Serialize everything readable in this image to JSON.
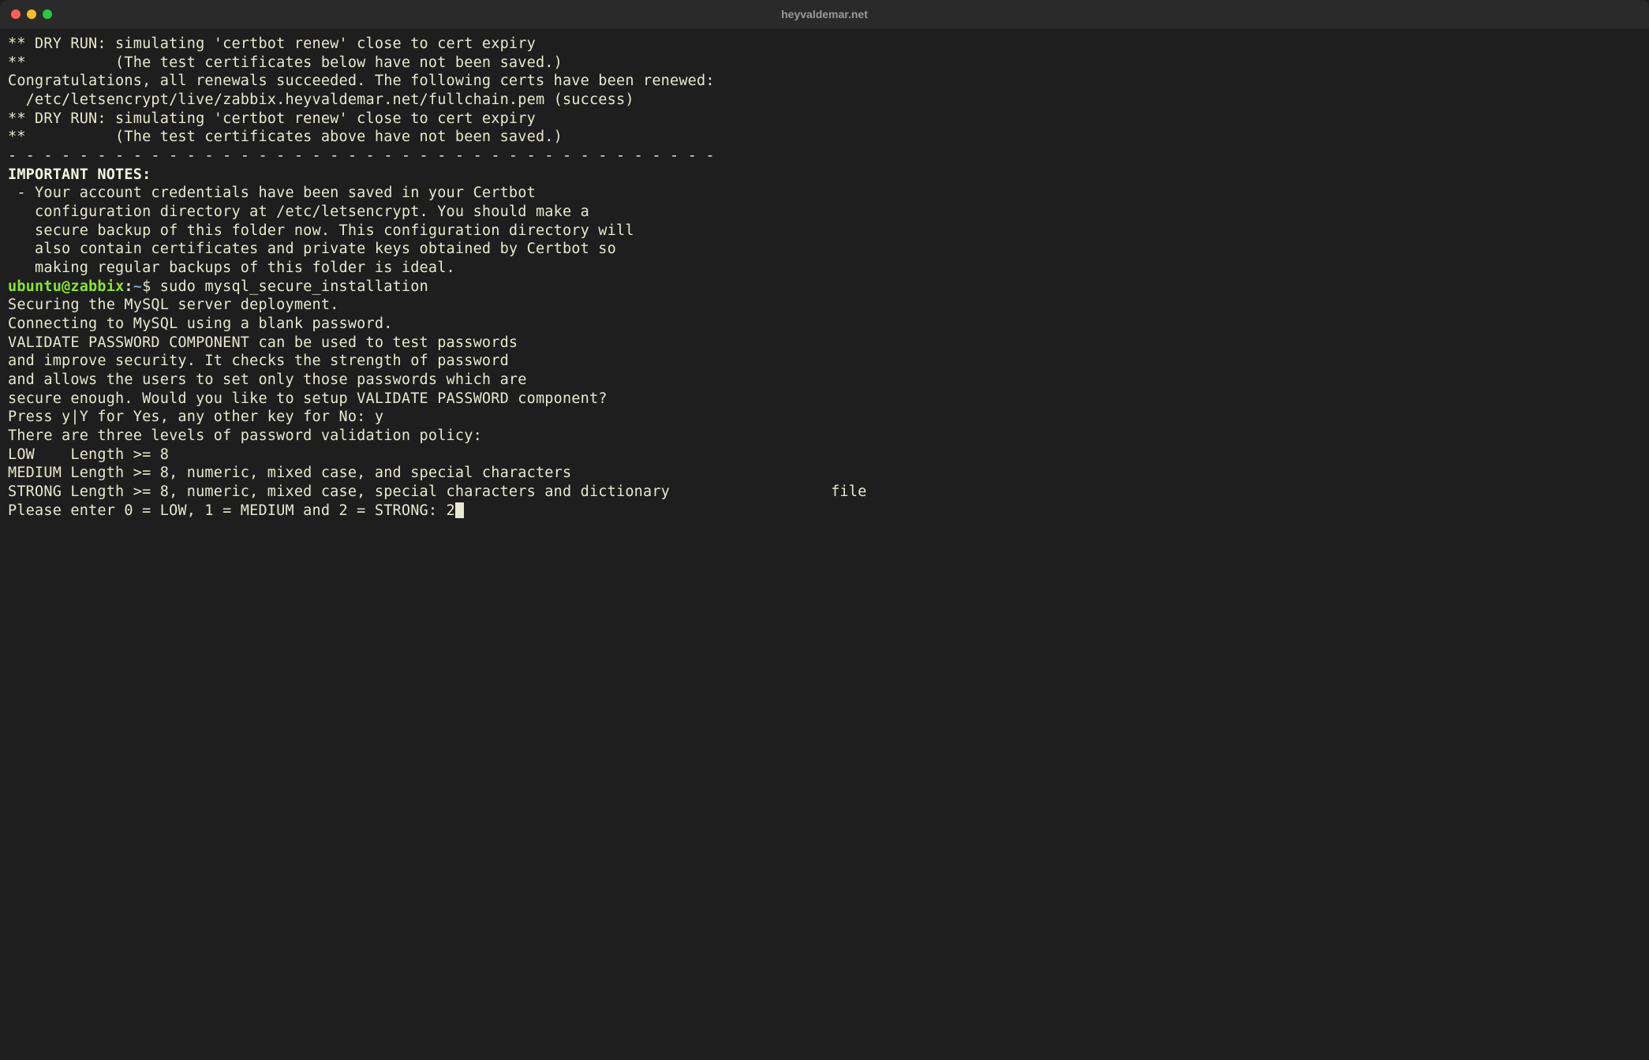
{
  "titlebar": {
    "title": "heyvaldemar.net"
  },
  "lines": {
    "l1": "** DRY RUN: simulating 'certbot renew' close to cert expiry",
    "l2": "**          (The test certificates below have not been saved.)",
    "l3": "",
    "l4": "Congratulations, all renewals succeeded. The following certs have been renewed:",
    "l5": "  /etc/letsencrypt/live/zabbix.heyvaldemar.net/fullchain.pem (success)",
    "l6": "** DRY RUN: simulating 'certbot renew' close to cert expiry",
    "l7": "**          (The test certificates above have not been saved.)",
    "l8": "- - - - - - - - - - - - - - - - - - - - - - - - - - - - - - - - - - - - - - - -",
    "l9": "",
    "l10": "IMPORTANT NOTES:",
    "l11": " - Your account credentials have been saved in your Certbot",
    "l12": "   configuration directory at /etc/letsencrypt. You should make a",
    "l13": "   secure backup of this folder now. This configuration directory will",
    "l14": "   also contain certificates and private keys obtained by Certbot so",
    "l15": "   making regular backups of this folder is ideal.",
    "prompt_user": "ubuntu",
    "prompt_at": "@",
    "prompt_host": "zabbix",
    "prompt_colon": ":",
    "prompt_path": "~",
    "prompt_dollar": "$ ",
    "command": "sudo mysql_secure_installation",
    "l17": "",
    "l18": "Securing the MySQL server deployment.",
    "l19": "",
    "l20": "Connecting to MySQL using a blank password.",
    "l21": "",
    "l22": "VALIDATE PASSWORD COMPONENT can be used to test passwords",
    "l23": "and improve security. It checks the strength of password",
    "l24": "and allows the users to set only those passwords which are",
    "l25": "secure enough. Would you like to setup VALIDATE PASSWORD component?",
    "l26": "",
    "l27": "Press y|Y for Yes, any other key for No: y",
    "l28": "",
    "l29": "There are three levels of password validation policy:",
    "l30": "",
    "l31": "LOW    Length >= 8",
    "l32": "MEDIUM Length >= 8, numeric, mixed case, and special characters",
    "l33": "STRONG Length >= 8, numeric, mixed case, special characters and dictionary                  file",
    "l34": "",
    "l35": "Please enter 0 = LOW, 1 = MEDIUM and 2 = STRONG: 2"
  }
}
